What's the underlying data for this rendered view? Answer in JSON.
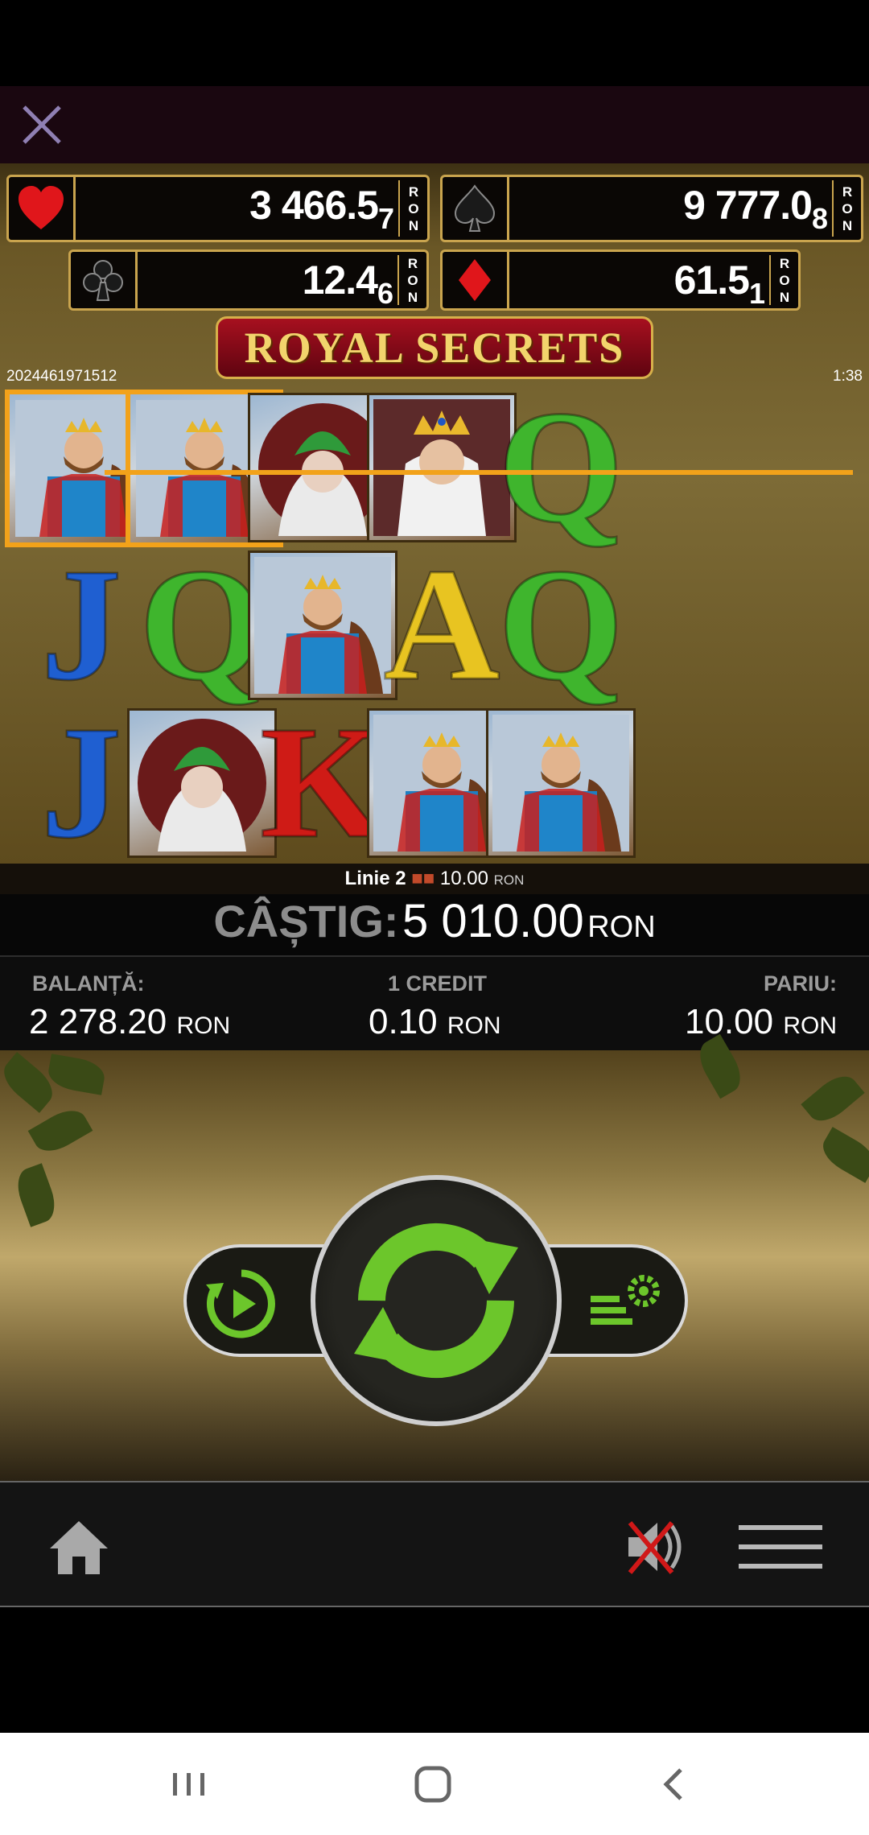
{
  "jackpots": {
    "heart": {
      "main": "3 466.5",
      "sub": "7",
      "cur1": "R",
      "cur2": "O",
      "cur3": "N"
    },
    "spade": {
      "main": "9 777.0",
      "sub": "8",
      "cur1": "R",
      "cur2": "O",
      "cur3": "N"
    },
    "club": {
      "main": "12.4",
      "sub": "6",
      "cur1": "R",
      "cur2": "O",
      "cur3": "N"
    },
    "diamond": {
      "main": "61.5",
      "sub": "1",
      "cur1": "R",
      "cur2": "O",
      "cur3": "N"
    }
  },
  "logo": "ROYAL SECRETS",
  "game_id": "2024461971512",
  "timer": "1:38",
  "reels": [
    [
      "king",
      "J",
      "J"
    ],
    [
      "king",
      "Q",
      "lady"
    ],
    [
      "lady",
      "king",
      "K"
    ],
    [
      "queen",
      "A",
      "king"
    ],
    [
      "Q",
      "Q",
      "king"
    ]
  ],
  "line_info": {
    "line": "Linie 2",
    "amount": "10.00",
    "currency": "RON"
  },
  "win": {
    "label": "CÂȘTIG:",
    "value": "5 010.00",
    "currency": "RON"
  },
  "info": {
    "balance_label": "BALANȚĂ:",
    "balance_value": "2 278.20",
    "balance_cur": "RON",
    "credit_label": "1 CREDIT",
    "credit_value": "0.10",
    "credit_cur": "RON",
    "bet_label": "PARIU:",
    "bet_value": "10.00",
    "bet_cur": "RON"
  },
  "icons": {
    "close": "close-icon",
    "autoplay": "autoplay-icon",
    "spin": "spin-icon",
    "settings": "bet-settings-icon",
    "home": "home-icon",
    "mute": "sound-muted-icon",
    "menu": "menu-icon"
  },
  "colors": {
    "win_frame": "#f2a21a",
    "spin_green": "#6cc62b",
    "gold": "#c9a44e"
  }
}
